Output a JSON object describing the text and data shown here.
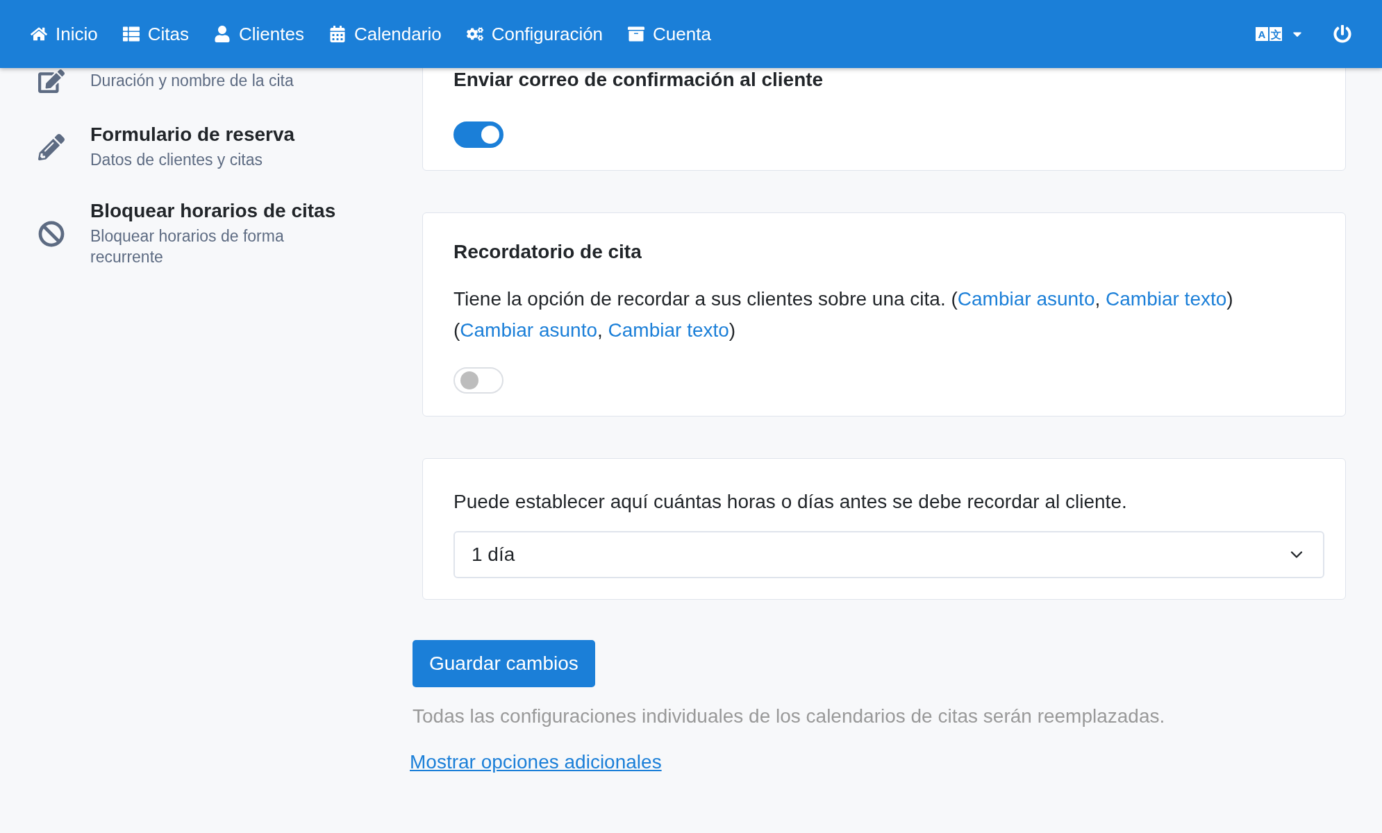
{
  "navbar": {
    "items": [
      {
        "label": "Inicio"
      },
      {
        "label": "Citas"
      },
      {
        "label": "Clientes"
      },
      {
        "label": "Calendario"
      },
      {
        "label": "Configuración"
      },
      {
        "label": "Cuenta"
      }
    ],
    "language_letters": [
      "A",
      "文"
    ]
  },
  "sidebar": {
    "items": [
      {
        "subtitle": "Duración y nombre de la cita"
      },
      {
        "title": "Formulario de reserva",
        "subtitle": "Datos de clientes y citas"
      },
      {
        "title": "Bloquear horarios de citas",
        "subtitle": "Bloquear horarios de forma recurrente"
      }
    ]
  },
  "confirmation_card": {
    "title": "Enviar correo de confirmación al cliente",
    "toggle": {
      "on": true
    }
  },
  "reminder_card": {
    "title": "Recordatorio de cita",
    "text": [
      {
        "kind": "text",
        "text": "Tiene la opción de recordar a sus clientes sobre una cita. ("
      },
      {
        "kind": "link",
        "text": "Cambiar asunto"
      },
      {
        "kind": "text",
        "text": ", "
      },
      {
        "kind": "link",
        "text": "Cambiar texto"
      },
      {
        "kind": "text",
        "text": ") ("
      },
      {
        "kind": "link",
        "text": "Cambiar asunto"
      },
      {
        "kind": "text",
        "text": ", "
      },
      {
        "kind": "link",
        "text": "Cambiar texto"
      },
      {
        "kind": "text",
        "text": ")"
      }
    ],
    "toggle": {
      "on": false
    }
  },
  "timing_card": {
    "label": "Puede establecer aquí cuántas horas o días antes se debe recordar al cliente.",
    "select_value": "1 día"
  },
  "save_button": "Guardar cambios",
  "save_note": "Todas las configuraciones individuales de los calendarios de citas serán reemplazadas.",
  "more_options_link": "Mostrar opciones adicionales"
}
